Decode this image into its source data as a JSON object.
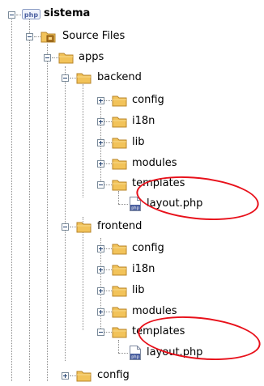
{
  "tree": {
    "project": {
      "label": "sistema",
      "badge": "php"
    },
    "source_files": "Source Files",
    "apps": "apps",
    "backend": {
      "label": "backend",
      "children": [
        "config",
        "i18n",
        "lib",
        "modules",
        "templates"
      ],
      "layout_file": "layout.php"
    },
    "frontend": {
      "label": "frontend",
      "children": [
        "config",
        "i18n",
        "lib",
        "modules",
        "templates"
      ],
      "layout_file": "layout.php"
    },
    "root_config": "config"
  },
  "colors": {
    "highlight_ring": "#e8101a",
    "folder": "#f2c35a",
    "tree_line": "#8c8c8c"
  },
  "icons": {
    "folder": "folder-icon",
    "source_folder": "source-files-icon",
    "php_project": "php-project-icon",
    "php_file": "php-file-icon",
    "expand": "expand-icon",
    "collapse": "collapse-icon"
  }
}
